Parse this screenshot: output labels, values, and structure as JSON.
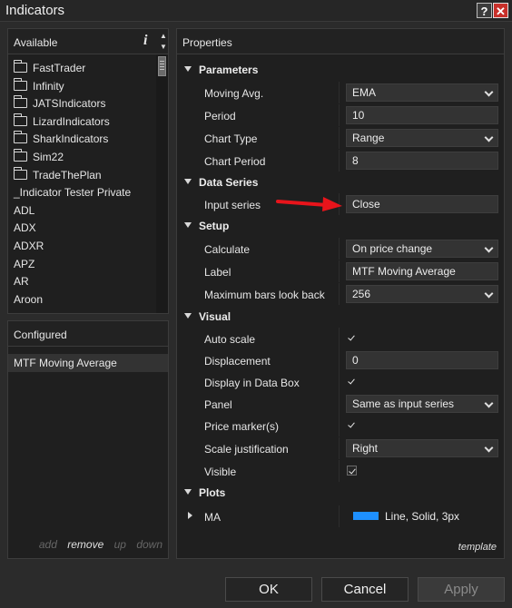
{
  "window": {
    "title": "Indicators",
    "help_icon": "?",
    "close_icon": "✕"
  },
  "available": {
    "header": "Available",
    "info_icon": "i",
    "scroll_up": "▲",
    "scroll_down": "▼",
    "items": [
      {
        "label": "FastTrader",
        "folder": true
      },
      {
        "label": "Infinity",
        "folder": true
      },
      {
        "label": "JATSIndicators",
        "folder": true
      },
      {
        "label": "LizardIndicators",
        "folder": true
      },
      {
        "label": "SharkIndicators",
        "folder": true
      },
      {
        "label": "Sim22",
        "folder": true
      },
      {
        "label": "TradeThePlan",
        "folder": true
      },
      {
        "label": "_Indicator Tester Private",
        "folder": false
      },
      {
        "label": "ADL",
        "folder": false
      },
      {
        "label": "ADX",
        "folder": false
      },
      {
        "label": "ADXR",
        "folder": false
      },
      {
        "label": "APZ",
        "folder": false
      },
      {
        "label": "AR",
        "folder": false
      },
      {
        "label": "Aroon",
        "folder": false
      }
    ]
  },
  "configured": {
    "header": "Configured",
    "items": [
      "MTF Moving Average"
    ],
    "actions": {
      "add": "add",
      "remove": "remove",
      "up": "up",
      "down": "down"
    }
  },
  "properties": {
    "header": "Properties",
    "parameters": {
      "label": "Parameters",
      "moving_avg": {
        "label": "Moving Avg.",
        "value": "EMA"
      },
      "period": {
        "label": "Period",
        "value": "10"
      },
      "chart_type": {
        "label": "Chart Type",
        "value": "Range"
      },
      "chart_period": {
        "label": "Chart Period",
        "value": "8"
      }
    },
    "data_series": {
      "label": "Data Series",
      "input_series": {
        "label": "Input series",
        "value": "Close"
      }
    },
    "setup": {
      "label": "Setup",
      "calculate": {
        "label": "Calculate",
        "value": "On price change"
      },
      "label_field": {
        "label": "Label",
        "value": "MTF Moving Average"
      },
      "max_bars": {
        "label": "Maximum bars look back",
        "value": "256"
      }
    },
    "visual": {
      "label": "Visual",
      "auto_scale": {
        "label": "Auto scale",
        "checked": true
      },
      "displacement": {
        "label": "Displacement",
        "value": "0"
      },
      "display_in_data_box": {
        "label": "Display in Data Box",
        "checked": true
      },
      "panel": {
        "label": "Panel",
        "value": "Same as input series"
      },
      "price_markers": {
        "label": "Price marker(s)",
        "checked": true
      },
      "scale_justification": {
        "label": "Scale justification",
        "value": "Right"
      },
      "visible": {
        "label": "Visible",
        "checked": true
      }
    },
    "plots": {
      "label": "Plots",
      "ma": {
        "label": "MA",
        "value": "Line, Solid, 3px",
        "color": "#1e90ff"
      }
    },
    "template_link": "template"
  },
  "annotation": {
    "arrow_color": "#e8141b"
  },
  "buttons": {
    "ok": "OK",
    "cancel": "Cancel",
    "apply": "Apply"
  }
}
